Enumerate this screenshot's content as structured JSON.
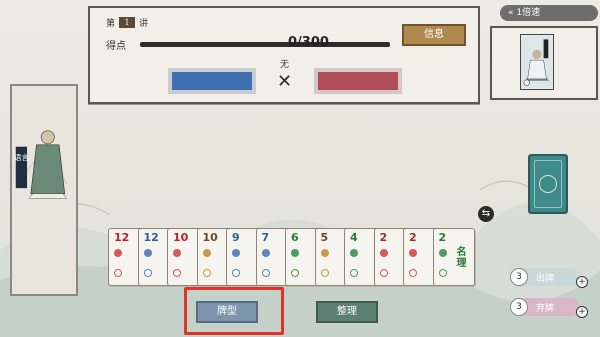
{
  "top_panel": {
    "round_prefix": "第",
    "round_number": "1",
    "round_suffix": "讲",
    "score_label": "得点",
    "progress_text": "0/300",
    "progress": 0,
    "info_button": "信息",
    "none_label": "无",
    "times_symbol": "✕",
    "colors": {
      "blue_box": "#3f6fae",
      "red_box": "#b14d58"
    }
  },
  "speed": {
    "label": "1倍速",
    "icon": "chevron-icon"
  },
  "right_character": {
    "icon": "character-portrait-icon"
  },
  "left_character": {
    "label": "语言",
    "icon": "character-portrait-icon"
  },
  "deck": {
    "icon": "deck-back-icon"
  },
  "swap": {
    "icon": "swap-icon",
    "glyph": "⇆"
  },
  "side_buttons": [
    {
      "count": "3",
      "label": "出牌",
      "plus": "+"
    },
    {
      "count": "3",
      "label": "弃牌",
      "plus": "+"
    }
  ],
  "hand": [
    {
      "num": "12",
      "glyph": "",
      "color": "#b3262c",
      "dot": "#d25b5b"
    },
    {
      "num": "12",
      "glyph": "",
      "color": "#2d5d99",
      "dot": "#5b86c2"
    },
    {
      "num": "10",
      "glyph": "",
      "color": "#b3262c",
      "dot": "#d25b5b"
    },
    {
      "num": "10",
      "glyph": "",
      "color": "#6c4a2a",
      "dot": "#c99a4b"
    },
    {
      "num": "9",
      "glyph": "",
      "color": "#2d5d99",
      "dot": "#5b86c2"
    },
    {
      "num": "7",
      "glyph": "",
      "color": "#2d5d99",
      "dot": "#5b86c2"
    },
    {
      "num": "6",
      "glyph": "",
      "color": "#2c7a3c",
      "dot": "#4f9c5f"
    },
    {
      "num": "5",
      "glyph": "",
      "color": "#6c4a2a",
      "dot": "#c99a4b"
    },
    {
      "num": "4",
      "glyph": "",
      "color": "#2c7a3c",
      "dot": "#4f9c5f"
    },
    {
      "num": "2",
      "glyph": "",
      "color": "#b3262c",
      "dot": "#d25b5b"
    },
    {
      "num": "2",
      "glyph": "",
      "color": "#b3262c",
      "dot": "#d25b5b"
    },
    {
      "num": "2",
      "glyph": "名理",
      "color": "#2c7a3c",
      "dot": "#4f9c5f"
    }
  ],
  "bottom_buttons": {
    "meld": "牌型",
    "sort": "整理"
  }
}
